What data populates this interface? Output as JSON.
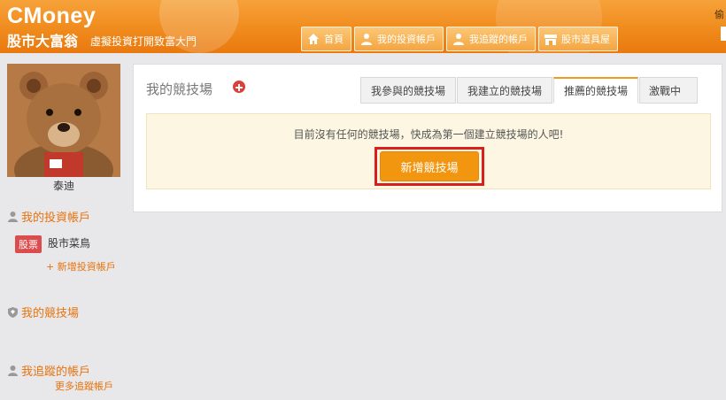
{
  "brand": {
    "logo": "CMoney",
    "product": "股市大富翁",
    "tagline": "虛擬投資打開致富大門"
  },
  "nav": [
    {
      "label": "首頁",
      "icon": "home-icon"
    },
    {
      "label": "我的投資帳戶",
      "icon": "user-icon"
    },
    {
      "label": "我追蹤的帳戶",
      "icon": "user-follow-icon"
    },
    {
      "label": "股市道具屋",
      "icon": "shop-icon"
    }
  ],
  "header_edge_text": "偷",
  "sidebar": {
    "user_name": "泰迪",
    "invest_section": "我的投資帳戶",
    "account_badge": "股票",
    "account_name": "股市菜鳥",
    "add_account_link": "+ 新增投資帳戶",
    "arena_section": "我的競技場",
    "follow_section": "我追蹤的帳戶",
    "more_follow_link": "更多追蹤帳戶"
  },
  "main": {
    "title": "我的競技場",
    "tabs": [
      {
        "label": "我參與的競技場",
        "active": false
      },
      {
        "label": "我建立的競技場",
        "active": false
      },
      {
        "label": "推薦的競技場",
        "active": true
      },
      {
        "label": "激戰中",
        "active": false
      }
    ],
    "empty_message": "目前沒有任何的競技場，快成為第一個建立競技場的人吧!",
    "create_button": "新增競技場"
  },
  "colors": {
    "header": "#f08b1d",
    "accent": "#e8720c",
    "button": "#f2960f",
    "highlight": "#d81f1f",
    "badge": "#dc4c4c"
  }
}
